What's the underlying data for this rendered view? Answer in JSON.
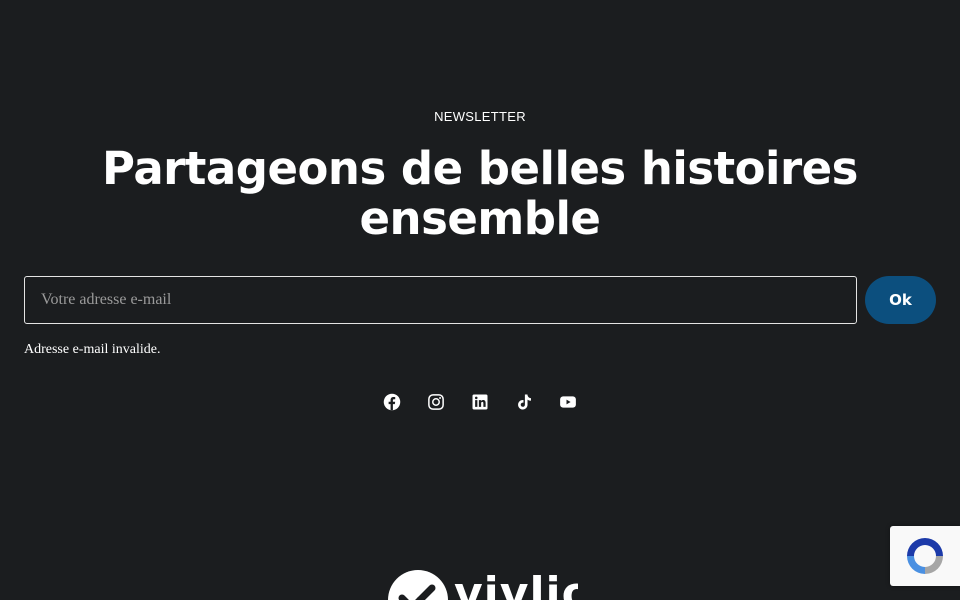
{
  "newsletter": {
    "eyebrow": "NEWSLETTER",
    "headline": "Partageons de belles histoires ensemble",
    "email_placeholder": "Votre adresse e-mail",
    "email_value": "",
    "submit_label": "Ok",
    "error_message": "Adresse e-mail invalide."
  },
  "socials": [
    {
      "name": "facebook",
      "icon": "facebook-icon"
    },
    {
      "name": "instagram",
      "icon": "instagram-icon"
    },
    {
      "name": "linkedin",
      "icon": "linkedin-icon"
    },
    {
      "name": "tiktok",
      "icon": "tiktok-icon"
    },
    {
      "name": "youtube",
      "icon": "youtube-icon"
    }
  ],
  "footer": {
    "logo_text": "vivlio"
  },
  "colors": {
    "background": "#1b1d1f",
    "button": "#0c4f7e",
    "text": "#ffffff"
  }
}
